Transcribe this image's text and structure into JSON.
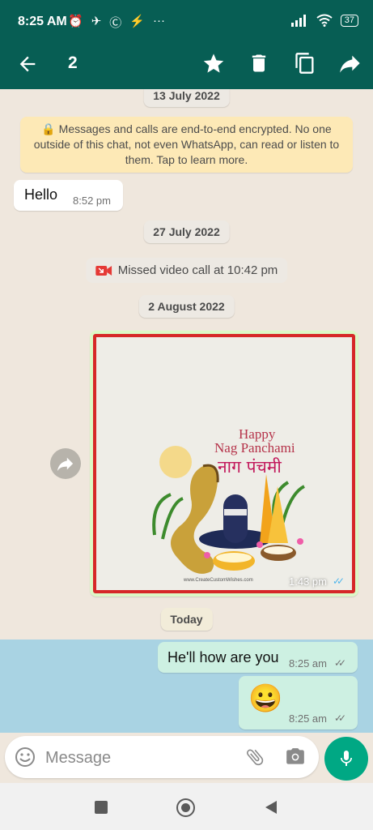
{
  "status_bar": {
    "time": "8:25 AM",
    "notification_icons": [
      "alarm-icon",
      "send-icon",
      "c-icon",
      "messenger-icon",
      "more-icon"
    ],
    "battery": "37"
  },
  "app_bar": {
    "selected_count": "2",
    "actions": [
      "back-arrow-icon",
      "star-icon",
      "delete-icon",
      "copy-icon",
      "forward-icon"
    ]
  },
  "chat": {
    "date_1": "13 July 2022",
    "encryption_notice": "Messages and calls are end-to-end encrypted. No one outside of this chat, not even WhatsApp, can read or listen to them. Tap to learn more.",
    "message_1": {
      "text": "Hello",
      "time": "8:52 pm"
    },
    "date_2": "27 July 2022",
    "missed_call": "Missed video call at 10:42 pm",
    "date_3": "2 August 2022",
    "image_message": {
      "card_line1": "Happy",
      "card_line2": "Nag Panchami",
      "card_line3": "नाग पंचमी",
      "watermark": "www.CreateCustomWishes.com",
      "time": "1:43 pm"
    },
    "date_4": "Today",
    "message_2": {
      "text": "He'll how are you",
      "time": "8:25 am"
    },
    "message_3": {
      "text": "😀",
      "time": "8:25 am"
    }
  },
  "composer": {
    "placeholder": "Message",
    "icons": [
      "emoji-icon",
      "attach-icon",
      "camera-icon",
      "mic-icon"
    ]
  },
  "colors": {
    "header": "#075e54",
    "outgoing_bubble": "#dcf8c6",
    "selection": "#a9d3e3",
    "accent": "#00a884",
    "read_ticks": "#4fb6ec"
  }
}
